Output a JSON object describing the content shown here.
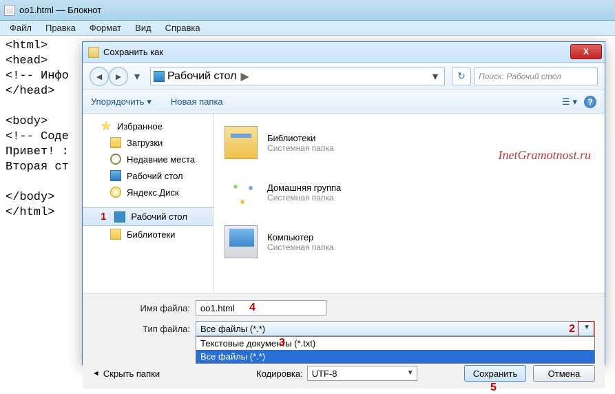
{
  "notepad": {
    "title": "oo1.html — Блокнот",
    "menus": {
      "file": "Файл",
      "edit": "Правка",
      "format": "Формат",
      "view": "Вид",
      "help": "Справка"
    },
    "body": "<html>\n<head>\n<!-- Инфо\n</head>\n\n<body>\n<!-- Соде\nПривет! :\nВторая ст\n\n</body>\n</html>"
  },
  "dialog": {
    "title": "Сохранить как",
    "close_glyph": "X",
    "breadcrumb": {
      "location": "Рабочий стол",
      "arrow": "▶"
    },
    "refresh_glyph": "↻",
    "search_placeholder": "Поиск: Рабочий стол",
    "toolbar": {
      "organize": "Упорядочить",
      "newfolder": "Новая папка",
      "help_glyph": "?"
    },
    "sidebar": {
      "favorites": "Избранное",
      "downloads": "Загрузки",
      "recent": "Недавние места",
      "desktop": "Рабочий стол",
      "yadisk": "Яндекс.Диск",
      "desktop2": "Рабочий стол",
      "libraries": "Библиотеки"
    },
    "content": {
      "libs": {
        "title": "Библиотеки",
        "sub": "Системная папка"
      },
      "home": {
        "title": "Домашняя группа",
        "sub": "Системная папка"
      },
      "comp": {
        "title": "Компьютер",
        "sub": "Системная папка"
      }
    },
    "watermark": "InetGramotnost.ru",
    "form": {
      "name_label": "Имя файла:",
      "name_value": "oo1.html",
      "type_label": "Тип файла:",
      "type_value": "Все файлы  (*.*)",
      "opt_txt": "Текстовые документы (*.txt)",
      "opt_all": "Все файлы  (*.*)",
      "hide": "Скрыть папки",
      "enc_label": "Кодировка:",
      "enc_value": "UTF-8",
      "save": "Сохранить",
      "cancel": "Отмена"
    },
    "annotations": {
      "n1": "1",
      "n2": "2",
      "n3": "3",
      "n4": "4",
      "n5": "5"
    }
  }
}
